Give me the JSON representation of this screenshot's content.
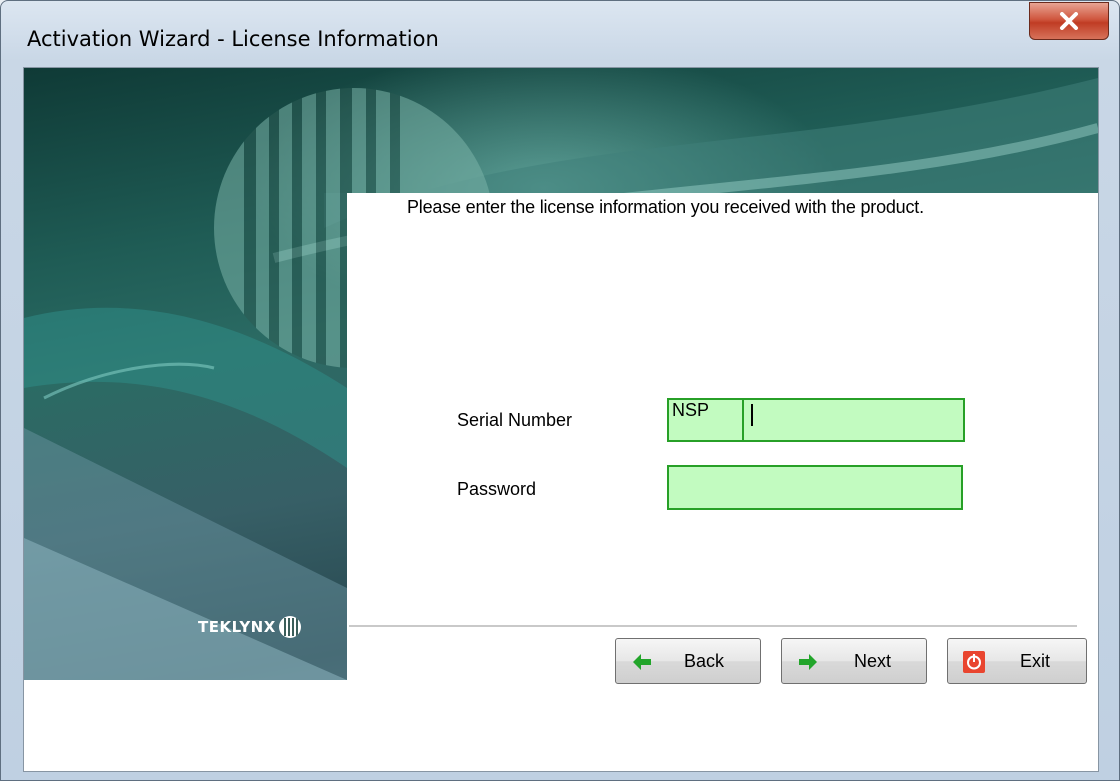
{
  "window": {
    "title": "Activation Wizard - License Information"
  },
  "wizard": {
    "instruction": "Please enter the license information you received with the product.",
    "brand": "TEKLYNX",
    "serial": {
      "label": "Serial Number",
      "prefix": "NSP",
      "value": ""
    },
    "password": {
      "label": "Password",
      "value": ""
    }
  },
  "buttons": {
    "back": "Back",
    "next": "Next",
    "exit": "Exit"
  },
  "colors": {
    "field_bg": "#c2fbc0",
    "field_border": "#27a027",
    "close_button": "#c7432b"
  },
  "icons": {
    "back": "arrow-left-icon",
    "next": "arrow-right-icon",
    "exit": "power-icon",
    "close": "close-icon"
  }
}
